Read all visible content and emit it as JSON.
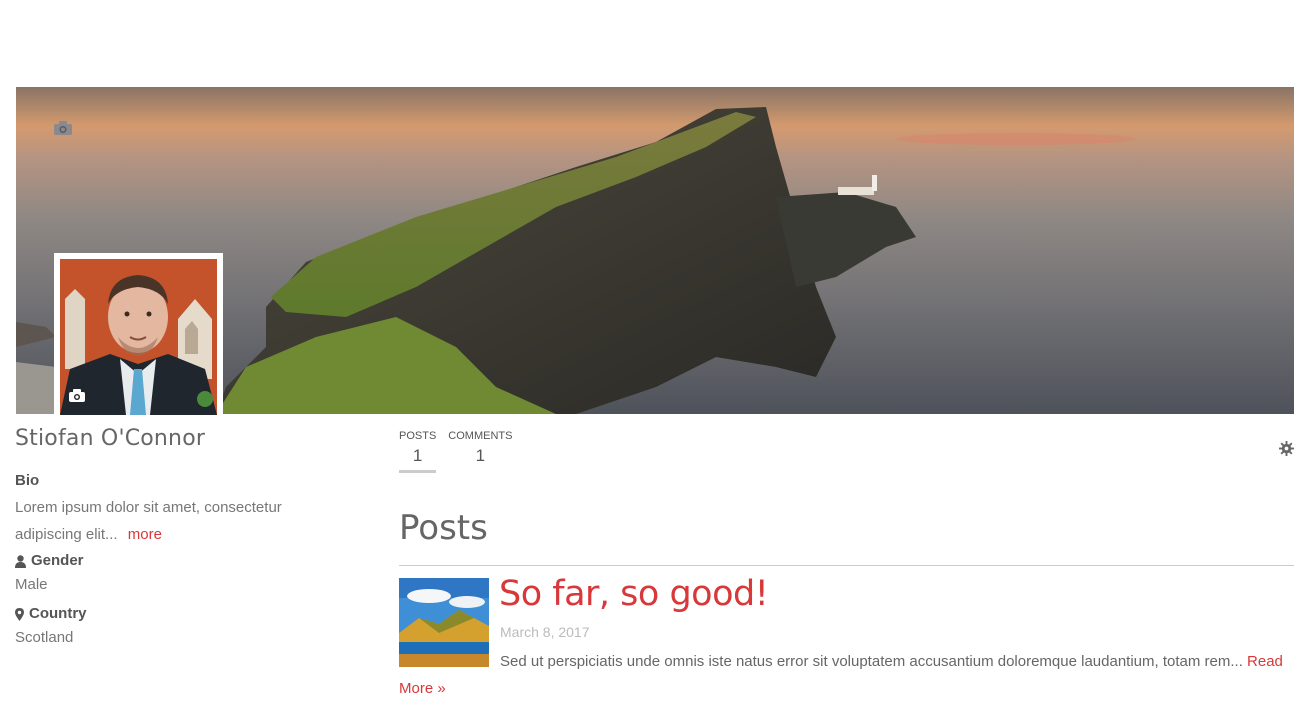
{
  "profile": {
    "name": "Stiofan O'Connor",
    "bio_label": "Bio",
    "bio_text": "Lorem ipsum dolor sit amet, consectetur adipiscing elit...",
    "bio_more": "more",
    "gender_label": "Gender",
    "gender_value": "Male",
    "country_label": "Country",
    "country_value": "Scotland"
  },
  "stats": [
    {
      "label": "POSTS",
      "count": "1"
    },
    {
      "label": "COMMENTS",
      "count": "1"
    }
  ],
  "posts": {
    "heading": "Posts",
    "items": [
      {
        "title": "So far, so good!",
        "date": "March 8, 2017",
        "excerpt": "Sed ut perspiciatis unde omnis iste natus error sit voluptatem accusantium doloremque laudantium, totam rem...",
        "read_more": "Read More »"
      }
    ]
  },
  "icons": {
    "cover_camera": "camera-icon",
    "avatar_camera": "camera-icon",
    "gender": "user-icon",
    "country": "map-marker-icon",
    "settings": "gear-icon"
  },
  "colors": {
    "accent": "#d9383a",
    "text": "#666666",
    "muted": "#bbbbbb"
  }
}
